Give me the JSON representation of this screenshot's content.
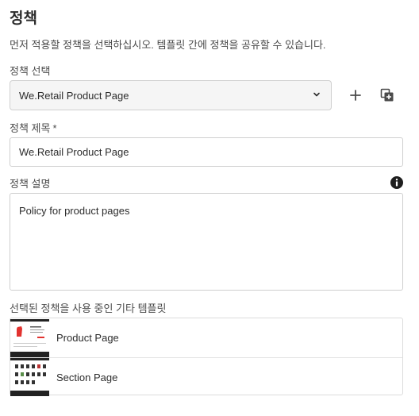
{
  "header": {
    "title": "정책",
    "description": "먼저 적용할 정책을 선택하십시오. 템플릿 간에 정책을 공유할 수 있습니다."
  },
  "policy_select": {
    "label": "정책 선택",
    "value": "We.Retail Product Page"
  },
  "policy_title": {
    "label": "정책 제목",
    "required_mark": "*",
    "value": "We.Retail Product Page"
  },
  "policy_description": {
    "label": "정책 설명",
    "value": "Policy for product pages"
  },
  "templates": {
    "label": "선택된 정책을 사용 중인 기타 템플릿",
    "items": [
      {
        "name": "Product Page"
      },
      {
        "name": "Section Page"
      }
    ]
  },
  "icons": {
    "add": "plus-icon",
    "duplicate": "duplicate-icon",
    "info": "info-icon",
    "chevron": "chevron-down-icon"
  },
  "colors": {
    "text": "#2c2c2c",
    "border": "#d0d0d0",
    "select_bg": "#f5f5f5",
    "accent_red": "#e2322f"
  }
}
